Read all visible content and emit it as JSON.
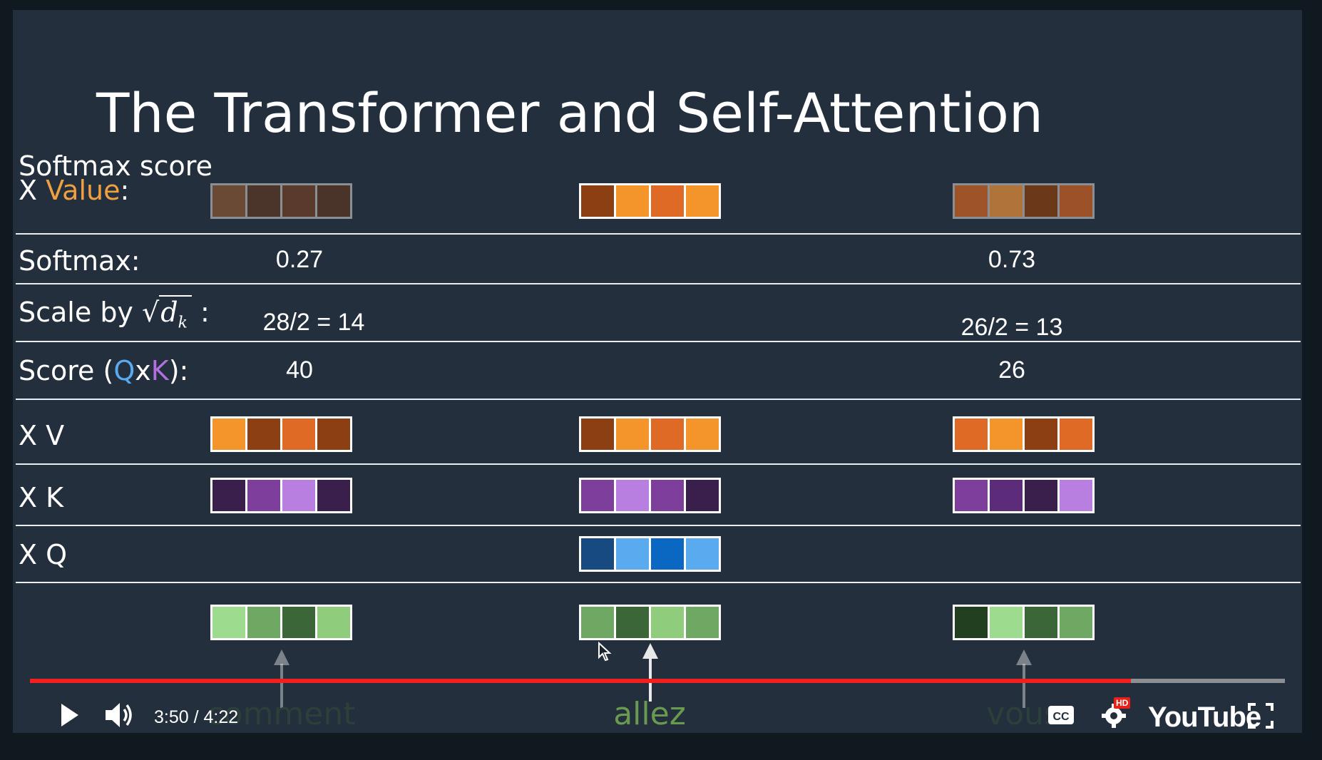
{
  "slide": {
    "title": "The Transformer and Self-Attention",
    "rows": {
      "softmax_value": {
        "label_line1": "Softmax score",
        "label_x": "X ",
        "label_value": "Value",
        "label_colon": ":"
      },
      "softmax": {
        "label": "Softmax:",
        "values": [
          "0.27",
          "0.73"
        ]
      },
      "scale": {
        "label_prefix": "Scale by ",
        "label_d": "d",
        "label_k": "k",
        "label_colon": " :",
        "values": [
          "28/2 = 14",
          "26/2 = 13"
        ]
      },
      "score": {
        "label_prefix": "Score (",
        "q": "Q",
        "x": "x",
        "k": "K",
        "label_suffix": "):",
        "values": [
          "40",
          "26"
        ]
      },
      "xv": {
        "label": "X V"
      },
      "xk": {
        "label": "X K"
      },
      "xq": {
        "label": "X Q"
      }
    },
    "vectors": {
      "softmax_value": [
        [
          "#6a4a35",
          "#4b3429",
          "#5a3a2c",
          "#4a3429"
        ],
        [
          "#8c3f12",
          "#f3952a",
          "#de6a26",
          "#f3952a"
        ],
        [
          "#9e5329",
          "#b0733a",
          "#6b3819",
          "#9c5129"
        ]
      ],
      "xv": [
        [
          "#f3952a",
          "#8c3f12",
          "#de6a26",
          "#8c3f12"
        ],
        [
          "#8c3f12",
          "#f3952a",
          "#de6a26",
          "#f3952a"
        ],
        [
          "#de6a26",
          "#f3952a",
          "#8c3f12",
          "#de6a26"
        ]
      ],
      "xk": [
        [
          "#3a1e4c",
          "#7e3f9c",
          "#b97fe0",
          "#3a1e4c"
        ],
        [
          "#7e3f9c",
          "#b97fe0",
          "#7e3f9c",
          "#3a1e4c"
        ],
        [
          "#7e3f9c",
          "#5c2c7a",
          "#3a1e4c",
          "#b97fe0"
        ]
      ],
      "xq": [
        [
          "#164a80",
          "#5aaaf0",
          "#0a68c2",
          "#5aaaf0"
        ]
      ],
      "embedding": [
        [
          "#9ddc8f",
          "#6fa863",
          "#3b6637",
          "#8fcd7d"
        ],
        [
          "#6fa863",
          "#3b6637",
          "#8fcd7d",
          "#6fa863"
        ],
        [
          "#223f20",
          "#9ddc8f",
          "#3b6637",
          "#6fa863"
        ]
      ]
    },
    "words": [
      "comment",
      "allez",
      "vous"
    ],
    "colors": {
      "value": "#f0a040",
      "q": "#5aaaf0",
      "k": "#b070e0",
      "word_active": "#6a9a50",
      "word_faded": "#2c3f3a"
    }
  },
  "player": {
    "time_current": "3:50",
    "time_separator": " / ",
    "time_total": "4:22",
    "progress": 0.877,
    "logo": "YouTube",
    "hd_badge": "HD",
    "icons": [
      "play-icon",
      "volume-icon",
      "captions-icon",
      "settings-icon",
      "fullscreen-icon"
    ]
  }
}
